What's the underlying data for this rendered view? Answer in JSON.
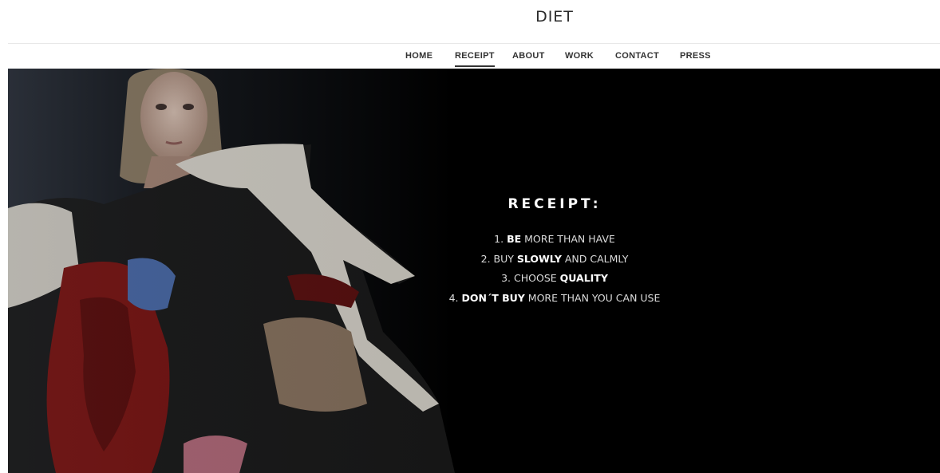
{
  "site": {
    "title": "DIET"
  },
  "nav": {
    "items": [
      {
        "label": "HOME",
        "active": false
      },
      {
        "label": "RECEIPT",
        "active": true
      },
      {
        "label": "ABOUT",
        "active": false
      },
      {
        "label": "WORK",
        "active": false
      },
      {
        "label": "CONTACT",
        "active": false
      },
      {
        "label": "PRESS",
        "active": false
      }
    ]
  },
  "hero": {
    "heading": "RECEIPT:",
    "lines": [
      {
        "pre": "1. ",
        "bold": "BE",
        "post": " MORE THAN HAVE"
      },
      {
        "pre": "2. BUY ",
        "bold": "SLOWLY",
        "post": " AND CALMLY"
      },
      {
        "pre": "3. CHOOSE ",
        "bold": "QUALITY",
        "post": ""
      },
      {
        "pre": "4. ",
        "bold": "DON´T BUY",
        "post": " MORE THAN YOU CAN USE"
      }
    ]
  },
  "colors": {
    "hero_background": "#000000",
    "text_dark": "#333333",
    "text_light": "#dcdcdc"
  }
}
